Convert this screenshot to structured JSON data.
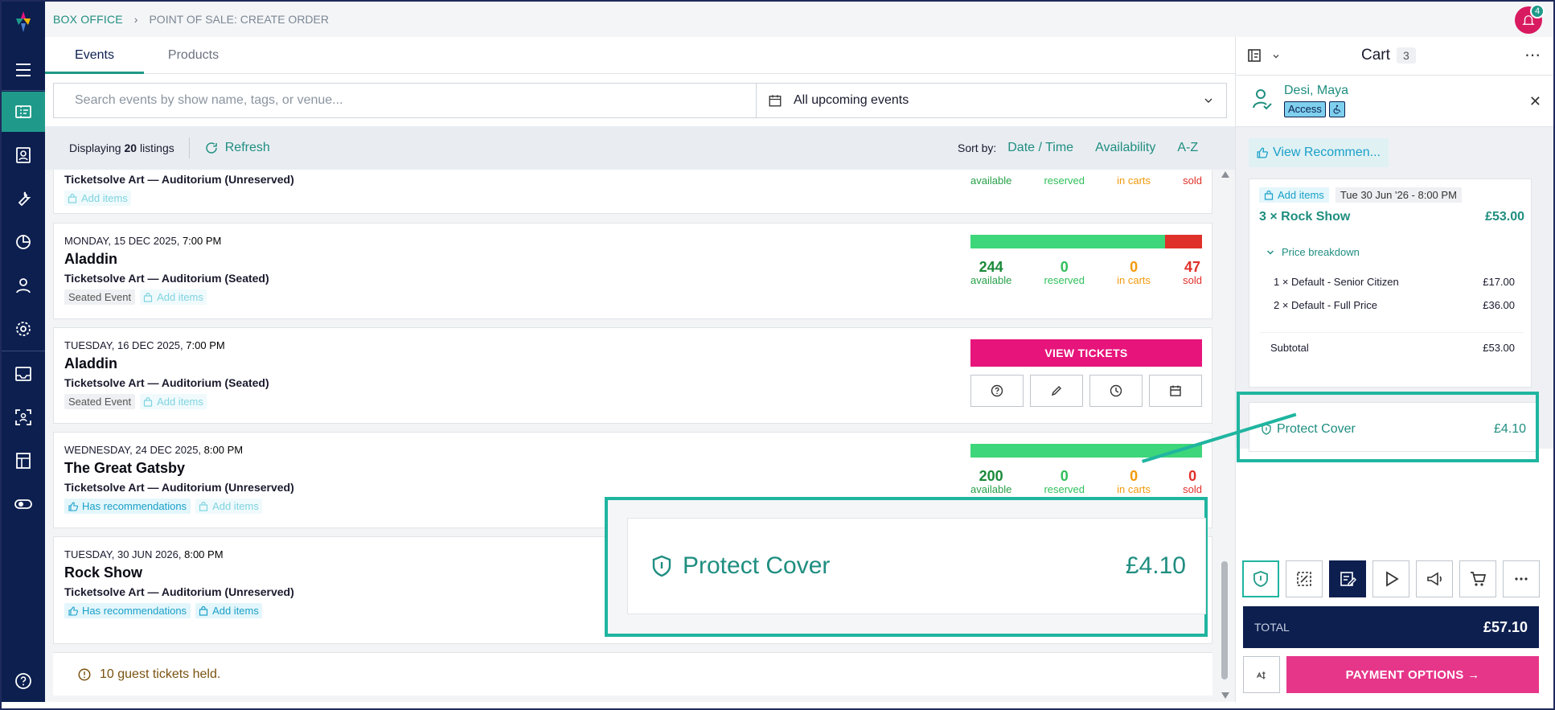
{
  "breadcrumb": {
    "root": "BOX OFFICE",
    "current": "POINT OF SALE: CREATE ORDER"
  },
  "notifications": {
    "count": "4"
  },
  "tabs": [
    {
      "label": "Events"
    },
    {
      "label": "Products"
    }
  ],
  "search": {
    "placeholder": "Search events by show name, tags, or venue...",
    "value": ""
  },
  "date_filter": {
    "selected": "All upcoming events"
  },
  "listing_bar": {
    "displaying_prefix": "Displaying",
    "count": "20",
    "suffix": "listings",
    "refresh_label": "Refresh",
    "sort_label": "Sort by:",
    "sort_options": [
      "Date / Time",
      "Availability",
      "A-Z"
    ]
  },
  "events": [
    {
      "venue": "Ticketsolve Art — Auditorium (Unreserved)",
      "add_label": "Add items",
      "stats": {
        "available_label": "available",
        "reserved_label": "reserved",
        "in_carts_label": "in carts",
        "sold_label": "sold"
      }
    },
    {
      "date": "MONDAY, 15 DEC 2025,",
      "time": "7:00 PM",
      "title": "Aladdin",
      "venue": "Ticketsolve Art — Auditorium (Seated)",
      "tag": "Seated Event",
      "add_label": "Add items",
      "availability_fill": 0.84,
      "stats": {
        "available": "244",
        "reserved": "0",
        "in_carts": "0",
        "sold": "47",
        "available_label": "available",
        "reserved_label": "reserved",
        "in_carts_label": "in carts",
        "sold_label": "sold"
      }
    },
    {
      "date": "TUESDAY, 16 DEC 2025,",
      "time": "7:00 PM",
      "title": "Aladdin",
      "venue": "Ticketsolve Art — Auditorium (Seated)",
      "tag": "Seated Event",
      "add_label": "Add items",
      "view_tickets": "VIEW TICKETS"
    },
    {
      "date": "WEDNESDAY, 24 DEC 2025,",
      "time": "8:00 PM",
      "title": "The Great Gatsby",
      "venue": "Ticketsolve Art — Auditorium (Unreserved)",
      "rec_label": "Has recommendations",
      "add_label": "Add items",
      "availability_fill": 1.0,
      "stats": {
        "available": "200",
        "reserved": "0",
        "in_carts": "0",
        "sold": "0",
        "available_label": "available",
        "reserved_label": "reserved",
        "in_carts_label": "in carts",
        "sold_label": "sold"
      }
    },
    {
      "date": "TUESDAY, 30 JUN 2026,",
      "time": "8:00 PM",
      "title": "Rock Show",
      "venue": "Ticketsolve Art — Auditorium (Unreserved)",
      "rec_label": "Has recommendations",
      "add_label": "Add items"
    }
  ],
  "guest_note": "10 guest tickets held.",
  "cart": {
    "title": "Cart",
    "count": "3",
    "customer": {
      "name": "Desi, Maya",
      "badge": "Access"
    },
    "recommendations_btn": "View Recommen...",
    "item": {
      "add_label": "Add items",
      "date": "Tue 30 Jun '26 - 8:00 PM",
      "line": "3 × Rock Show",
      "line_price": "£53.00",
      "price_breakdown_label": "Price breakdown",
      "breakdown": [
        {
          "label": "1 × Default - Senior Citizen",
          "price": "£17.00"
        },
        {
          "label": "2 × Default - Full Price",
          "price": "£36.00"
        }
      ],
      "subtotal_label": "Subtotal",
      "subtotal": "£53.00"
    },
    "protect": {
      "label": "Protect Cover",
      "price": "£4.10"
    },
    "total_label": "TOTAL",
    "total": "£57.10",
    "pay_label": "PAYMENT OPTIONS →"
  },
  "colors": {
    "sidebar": "#0c1f4f",
    "accent": "#1f9a8a",
    "pink": "#e6147b",
    "highlight": "#1fb5a0"
  }
}
